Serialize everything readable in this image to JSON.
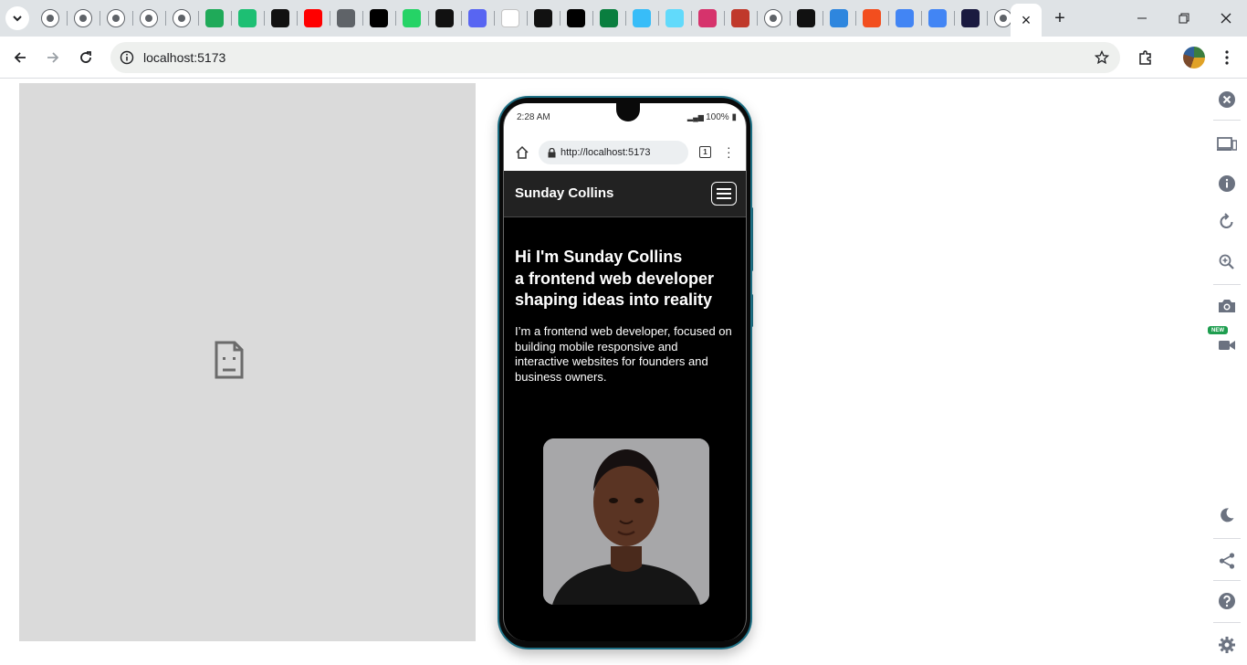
{
  "browser": {
    "pinned_tabs": [
      {
        "icon": "tab-search-chevron-icon"
      },
      {
        "icon": "globe-icon",
        "color": "#5f6368"
      },
      {
        "icon": "globe-icon",
        "color": "#5f6368"
      },
      {
        "icon": "globe-icon",
        "color": "#5f6368"
      },
      {
        "icon": "globe-icon",
        "color": "#5f6368"
      },
      {
        "icon": "globe-icon",
        "color": "#5f6368"
      },
      {
        "icon": "green-chat-icon",
        "color": "#1faa59"
      },
      {
        "icon": "fiverr-icon",
        "color": "#1dbf73"
      },
      {
        "icon": "upwork-icon",
        "color": "#111111"
      },
      {
        "icon": "youtube-icon",
        "color": "#ff0000"
      },
      {
        "icon": "linkedin-icon",
        "color": "#5f6368"
      },
      {
        "icon": "x-icon",
        "color": "#000000"
      },
      {
        "icon": "whatsapp-icon",
        "color": "#25d366"
      },
      {
        "icon": "threads-icon",
        "color": "#111111"
      },
      {
        "icon": "discord-icon",
        "color": "#5865f2"
      },
      {
        "icon": "blank-page-icon",
        "color": "#ffffff"
      },
      {
        "icon": "github-icon",
        "color": "#111111"
      },
      {
        "icon": "vercel-icon",
        "color": "#000000"
      },
      {
        "icon": "w-icon",
        "color": "#0a7e3f"
      },
      {
        "icon": "tailwind-icon",
        "color": "#38bdf8"
      },
      {
        "icon": "react-icon",
        "color": "#61dafb"
      },
      {
        "icon": "react-icon",
        "color": "#d6336c"
      },
      {
        "icon": "chart-icon",
        "color": "#c0392b"
      },
      {
        "icon": "globe-icon",
        "color": "#5f6368"
      },
      {
        "icon": "hashnode-icon",
        "color": "#111111"
      },
      {
        "icon": "c-icon",
        "color": "#2e86de"
      },
      {
        "icon": "figma-icon",
        "color": "#f24e1e"
      },
      {
        "icon": "grid-icon",
        "color": "#4285f4"
      },
      {
        "icon": "google-icon",
        "color": "#4285f4"
      },
      {
        "icon": "code-icon",
        "color": "#1a1a40"
      },
      {
        "icon": "chrome-icon",
        "color": "#5f6368"
      }
    ],
    "active_tab_close": "×",
    "new_tab": "+",
    "address": "localhost:5173"
  },
  "phone": {
    "status_time": "2:28 AM",
    "status_right": "100%",
    "url": "http://localhost:5173",
    "tab_count": "1"
  },
  "site": {
    "brand": "Sunday Collins",
    "hero_line1": "Hi I'm Sunday Collins",
    "hero_line2": "a frontend web developer",
    "hero_line3": "shaping ideas into reality",
    "hero_text": "I’m a frontend web developer, focused on building mobile responsive and interactive websites for founders and business owners."
  },
  "sidebar": {
    "badge": "NEW"
  },
  "colors": {
    "accent": "#1d6f84",
    "nav_bg": "#222222",
    "page_bg": "#000000",
    "blocked_bg": "#dadada"
  }
}
